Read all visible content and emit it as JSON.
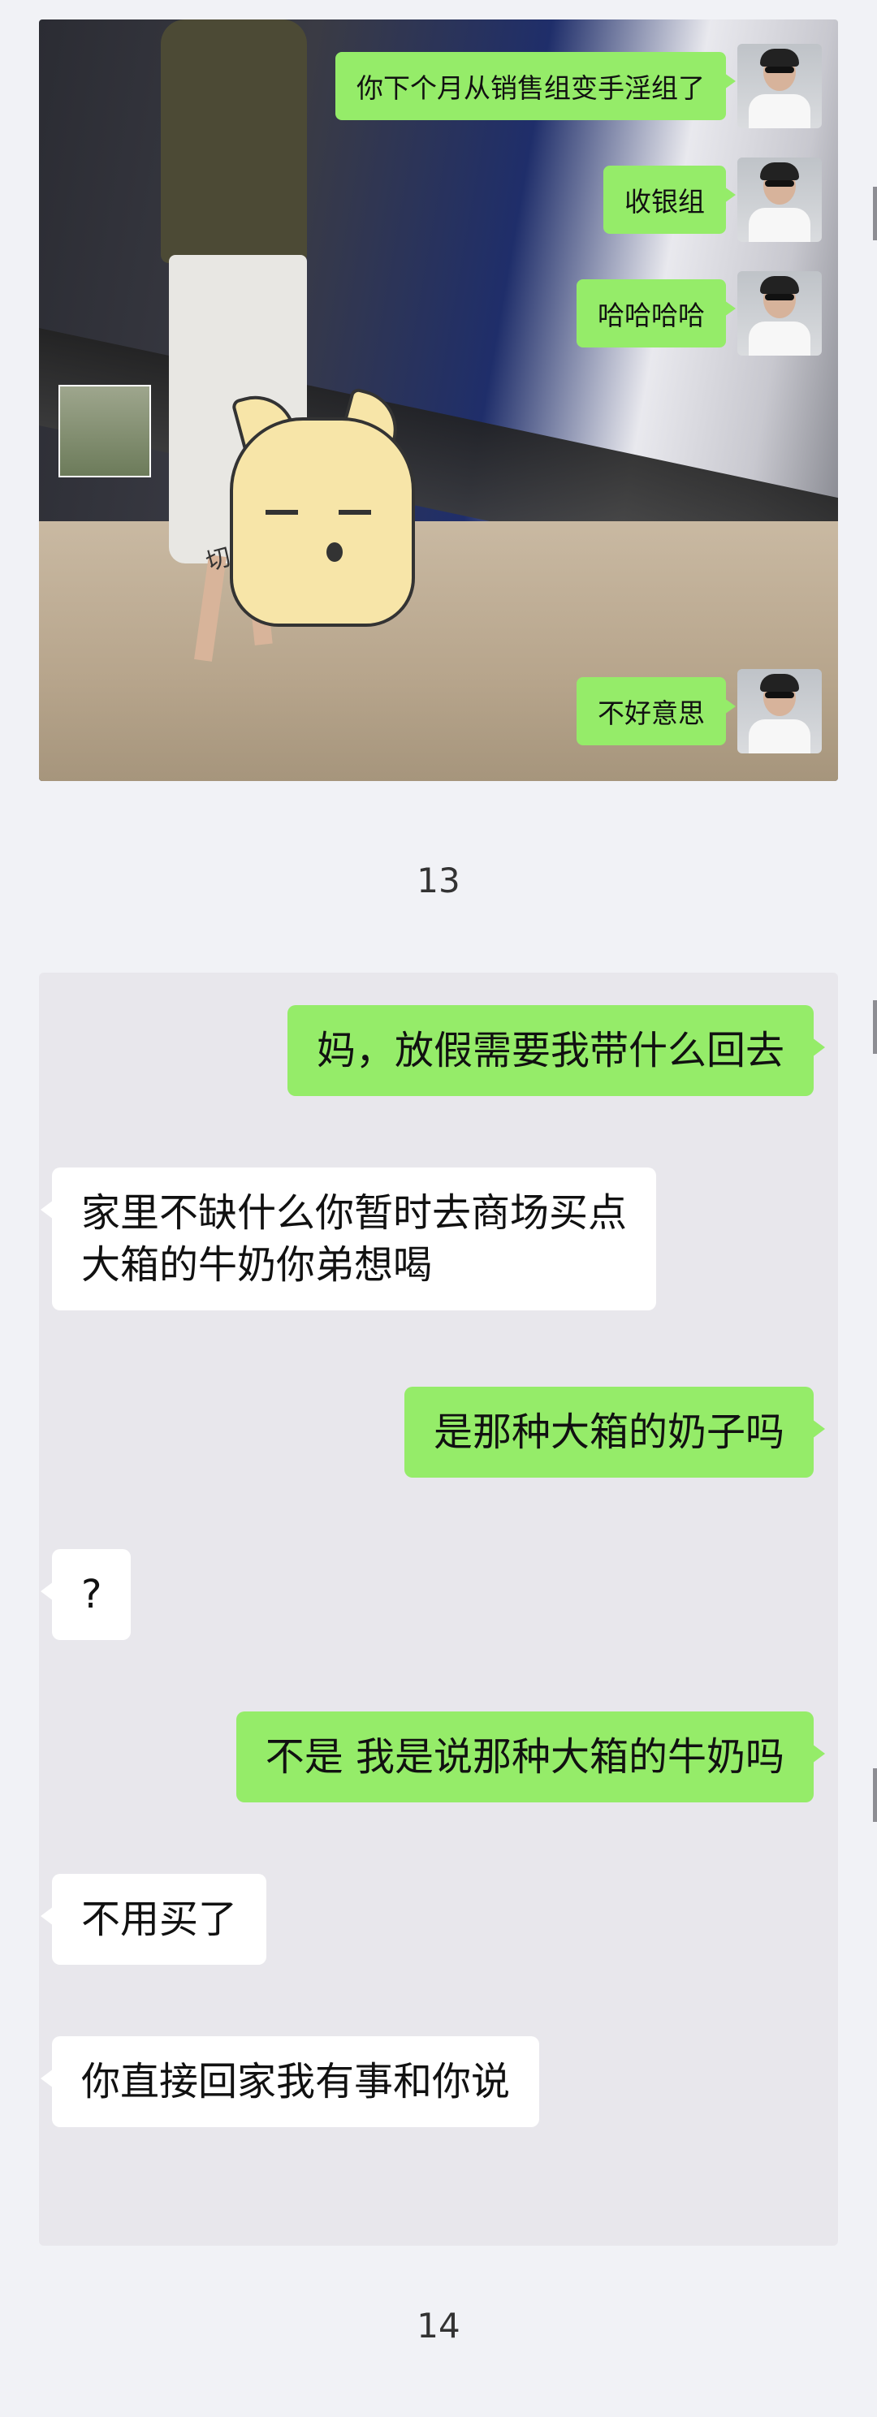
{
  "panel1": {
    "bubbles": [
      "你下个月从销售组变手淫组了",
      "收银组",
      "哈哈哈哈",
      "不好意思"
    ],
    "sticker_text": "切"
  },
  "caption1": "13",
  "panel2": {
    "messages": [
      {
        "side": "right",
        "text": "妈，放假需要我带什么回去"
      },
      {
        "side": "left",
        "text": "家里不缺什么你暂时去商场买点\n大箱的牛奶你弟想喝"
      },
      {
        "side": "right",
        "text": "是那种大箱的奶子吗"
      },
      {
        "side": "left",
        "text": "?"
      },
      {
        "side": "right",
        "text": "不是 我是说那种大箱的牛奶吗"
      },
      {
        "side": "left",
        "text": "不用买了"
      },
      {
        "side": "left",
        "text": "你直接回家我有事和你说"
      }
    ]
  },
  "caption2": "14",
  "colors": {
    "sent_bubble": "#95ec69",
    "received_bubble": "#ffffff",
    "background": "#f1f2f6"
  }
}
